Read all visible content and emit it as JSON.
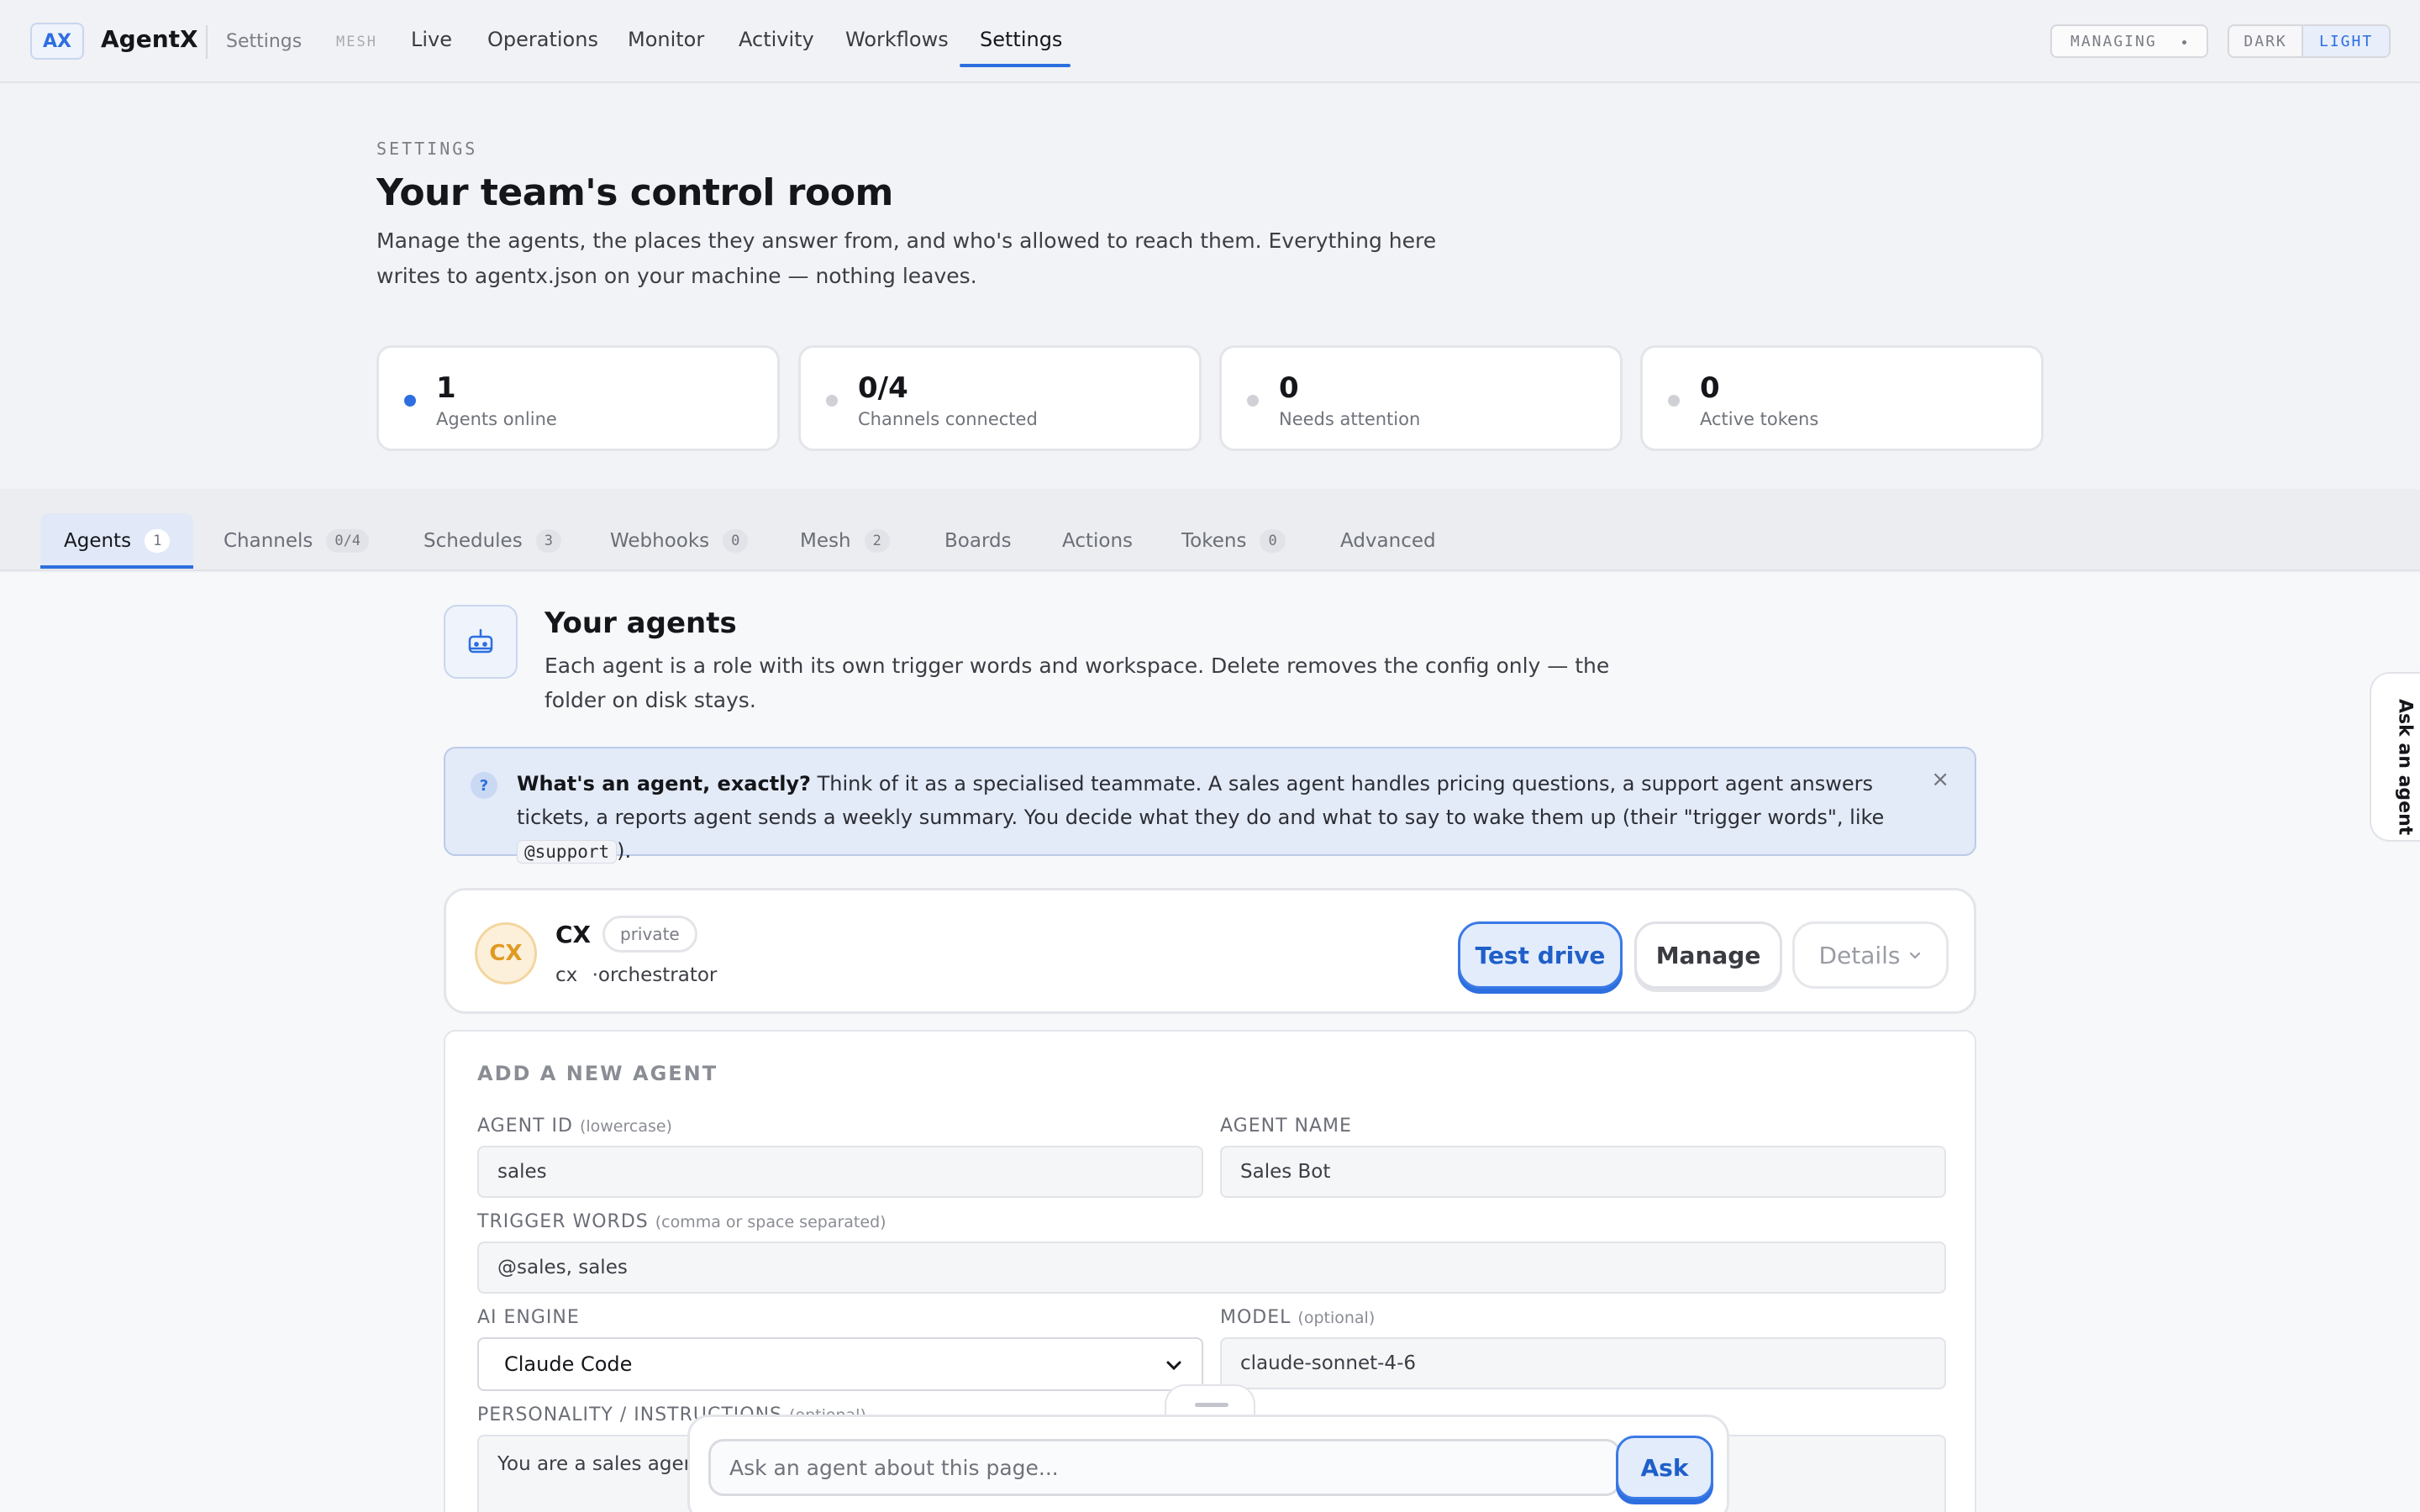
{
  "topbar": {
    "logo": "AX",
    "brand": "AgentX",
    "section": "Settings",
    "mesh_tag": "MESH",
    "nav": [
      {
        "label": "Live"
      },
      {
        "label": "Operations"
      },
      {
        "label": "Monitor"
      },
      {
        "label": "Activity"
      },
      {
        "label": "Workflows"
      },
      {
        "label": "Settings",
        "active": true
      }
    ],
    "managing": "MANAGING",
    "theme": {
      "dark": "DARK",
      "light": "LIGHT",
      "selected": "LIGHT"
    }
  },
  "header": {
    "eyebrow": "SETTINGS",
    "title": "Your team's control room",
    "description": "Manage the agents, the places they answer from, and who's allowed to reach them. Everything here writes to agentx.json on your machine — nothing leaves."
  },
  "stats": [
    {
      "value": "1",
      "label": "Agents online",
      "status": "active"
    },
    {
      "value": "0/4",
      "label": "Channels connected",
      "status": "idle"
    },
    {
      "value": "0",
      "label": "Needs attention",
      "status": "idle"
    },
    {
      "value": "0",
      "label": "Active tokens",
      "status": "idle"
    }
  ],
  "tabs": [
    {
      "label": "Agents",
      "badge": "1",
      "active": true
    },
    {
      "label": "Channels",
      "badge": "0/4"
    },
    {
      "label": "Schedules",
      "badge": "3"
    },
    {
      "label": "Webhooks",
      "badge": "0"
    },
    {
      "label": "Mesh",
      "badge": "2"
    },
    {
      "label": "Boards",
      "badge": ""
    },
    {
      "label": "Actions",
      "badge": ""
    },
    {
      "label": "Tokens",
      "badge": "0"
    },
    {
      "label": "Advanced",
      "badge": ""
    }
  ],
  "agents_section": {
    "title": "Your agents",
    "description": "Each agent is a role with its own trigger words and workspace. Delete removes the config only — the folder on disk stays.",
    "icon": "robot-icon"
  },
  "info_banner": {
    "icon": "?",
    "bold": "What's an agent, exactly?",
    "text_before_code": " Think of it as a specialised teammate. A sales agent handles pricing questions, a support agent answers tickets, a reports agent sends a weekly summary. You decide what they do and what to say to wake them up (their \"trigger words\", like ",
    "code": "@support",
    "text_after_code": ").",
    "close": "×"
  },
  "agent_card": {
    "initials": "CX",
    "name": "CX",
    "visibility": "private",
    "id": "cx",
    "role": "·orchestrator",
    "test_drive": "Test drive",
    "manage": "Manage",
    "details": "Details"
  },
  "new_agent_form": {
    "title": "ADD A NEW AGENT",
    "agent_id": {
      "label": "AGENT ID",
      "hint": "(lowercase)",
      "placeholder": "sales"
    },
    "agent_name": {
      "label": "AGENT NAME",
      "placeholder": "Sales Bot"
    },
    "trigger_words": {
      "label": "TRIGGER WORDS",
      "hint": "(comma or space separated)",
      "placeholder": "@sales, sales"
    },
    "ai_engine": {
      "label": "AI ENGINE",
      "value": "Claude Code"
    },
    "model": {
      "label": "MODEL",
      "hint": "(optional)",
      "placeholder": "claude-sonnet-4-6"
    },
    "personality": {
      "label": "PERSONALITY / INSTRUCTIONS",
      "hint": "(optional)",
      "placeholder": "You are a sales agent"
    }
  },
  "ask_bar": {
    "placeholder": "Ask an agent about this page...",
    "button": "Ask"
  },
  "side_tab": "Ask an agent",
  "colors": {
    "accent": "#2d6ee0",
    "avatar": "#e09a22"
  }
}
